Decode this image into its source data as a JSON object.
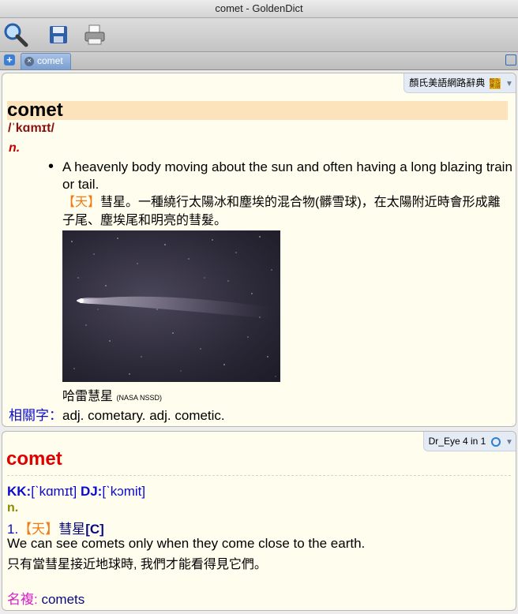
{
  "window": {
    "title": "comet - GoldenDict"
  },
  "toolbar": {
    "search_icon": "search-icon",
    "save_icon": "save-icon",
    "print_icon": "print-icon"
  },
  "tabs": [
    {
      "label": "comet"
    }
  ],
  "articles": [
    {
      "dictionary": "顏氏美語網路辭典",
      "dict_icon_text": "顏氏美語",
      "headword": "comet",
      "pronunciation": "/ˈkɑmɪt/",
      "pos": "n.",
      "definition_en": "A heavenly body moving about the sun and often having a long blazing train or tail.",
      "definition_tag": "【天】",
      "definition_zh": "彗星。一種繞行太陽冰和塵埃的混合物(髒雪球)，在太陽附近時會形成離子尾、塵埃尾和明亮的彗髮。",
      "image_caption": "哈雷慧星",
      "image_credit": "(NASA NSSD)",
      "related_label": "相關字：",
      "related_text": "adj. cometary. adj. cometic."
    },
    {
      "dictionary": "Dr_Eye 4 in 1",
      "headword": "comet",
      "kk_label": "KK:",
      "kk_value": "[ˋkɑmɪt]",
      "dj_label": "DJ:",
      "dj_value": "[ˋkɔmit]",
      "pos": "n.",
      "sense_number": "1.",
      "sense_tag": "【天】",
      "sense_zh": "彗星",
      "sense_grammar": "[C]",
      "example_en": "We can see comets only when they come close to the earth.",
      "example_zh": "只有當彗星接近地球時, 我們才能看得見它們。",
      "plural_label": "名複:",
      "plural_value": "comets"
    }
  ],
  "colors": {
    "article_bg": "#fffeee",
    "headword_highlight": "#fde3bb",
    "accent_blue": "#0a0ad0",
    "headword_red": "#e00000",
    "tag_orange": "#f07a16"
  }
}
